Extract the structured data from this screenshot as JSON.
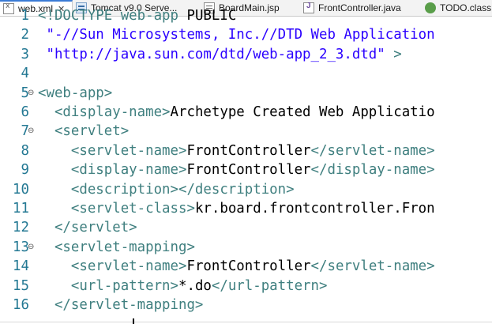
{
  "tabs": [
    {
      "label": "web.xml",
      "icon": "xml-file-icon",
      "active": true,
      "close": "✕"
    },
    {
      "label": "Tomcat v9.0 Serve...",
      "icon": "server-icon",
      "active": false
    },
    {
      "label": "BoardMain.jsp",
      "icon": "jsp-file-icon",
      "active": false
    },
    {
      "label": "FrontController.java",
      "icon": "java-file-icon",
      "active": false
    },
    {
      "label": "TODO.class",
      "icon": "class-file-icon",
      "active": false
    }
  ],
  "editor": {
    "lines": [
      {
        "n": "1",
        "fold": "",
        "code": [
          [
            "tag",
            "<!DOCTYPE web-app "
          ],
          [
            "plain",
            "PUBLIC"
          ]
        ]
      },
      {
        "n": "2",
        "fold": "",
        "code": [
          [
            "str",
            " \"-//Sun Microsystems, Inc.//DTD Web Application"
          ]
        ]
      },
      {
        "n": "3",
        "fold": "",
        "code": [
          [
            "str",
            " \"http://java.sun.com/dtd/web-app_2_3.dtd\""
          ],
          [
            "tag",
            " >"
          ]
        ]
      },
      {
        "n": "4",
        "fold": "",
        "code": []
      },
      {
        "n": "5",
        "fold": "⊖",
        "code": [
          [
            "tag",
            "<web-app>"
          ]
        ]
      },
      {
        "n": "6",
        "fold": "",
        "code": [
          [
            "tag",
            "  <display-name>"
          ],
          [
            "plain",
            "Archetype Created Web Applicatio"
          ]
        ]
      },
      {
        "n": "7",
        "fold": "⊖",
        "code": [
          [
            "tag",
            "  <servlet>"
          ]
        ]
      },
      {
        "n": "8",
        "fold": "",
        "code": [
          [
            "tag",
            "    <servlet-name>"
          ],
          [
            "plain",
            "FrontController"
          ],
          [
            "tag",
            "</servlet-name>"
          ]
        ]
      },
      {
        "n": "9",
        "fold": "",
        "code": [
          [
            "tag",
            "    <display-name>"
          ],
          [
            "plain",
            "FrontController"
          ],
          [
            "tag",
            "</display-name>"
          ]
        ]
      },
      {
        "n": "10",
        "fold": "",
        "code": [
          [
            "tag",
            "    <description></description>"
          ]
        ]
      },
      {
        "n": "11",
        "fold": "",
        "code": [
          [
            "tag",
            "    <servlet-class>"
          ],
          [
            "plain",
            "kr.board.frontcontroller.Fron"
          ]
        ]
      },
      {
        "n": "12",
        "fold": "",
        "code": [
          [
            "tag",
            "  </servlet>"
          ]
        ]
      },
      {
        "n": "13",
        "fold": "⊖",
        "code": [
          [
            "tag",
            "  <servlet-mapping>"
          ]
        ]
      },
      {
        "n": "14",
        "fold": "",
        "code": [
          [
            "tag",
            "    <servlet-name>"
          ],
          [
            "plain",
            "FrontController"
          ],
          [
            "tag",
            "</servlet-name>"
          ]
        ]
      },
      {
        "n": "15",
        "fold": "",
        "code": [
          [
            "tag",
            "    <url-pattern>"
          ],
          [
            "plain",
            "*.do"
          ],
          [
            "tag",
            "</url-pattern>"
          ]
        ]
      },
      {
        "n": "16",
        "fold": "",
        "code": [
          [
            "tag",
            "  </servlet-mapping>"
          ]
        ]
      }
    ]
  },
  "colors": {
    "tag": "#3f7f7f",
    "string": "#2a00ff",
    "line_number": "#237893",
    "active_tab_accent": "#3a7bd5"
  }
}
